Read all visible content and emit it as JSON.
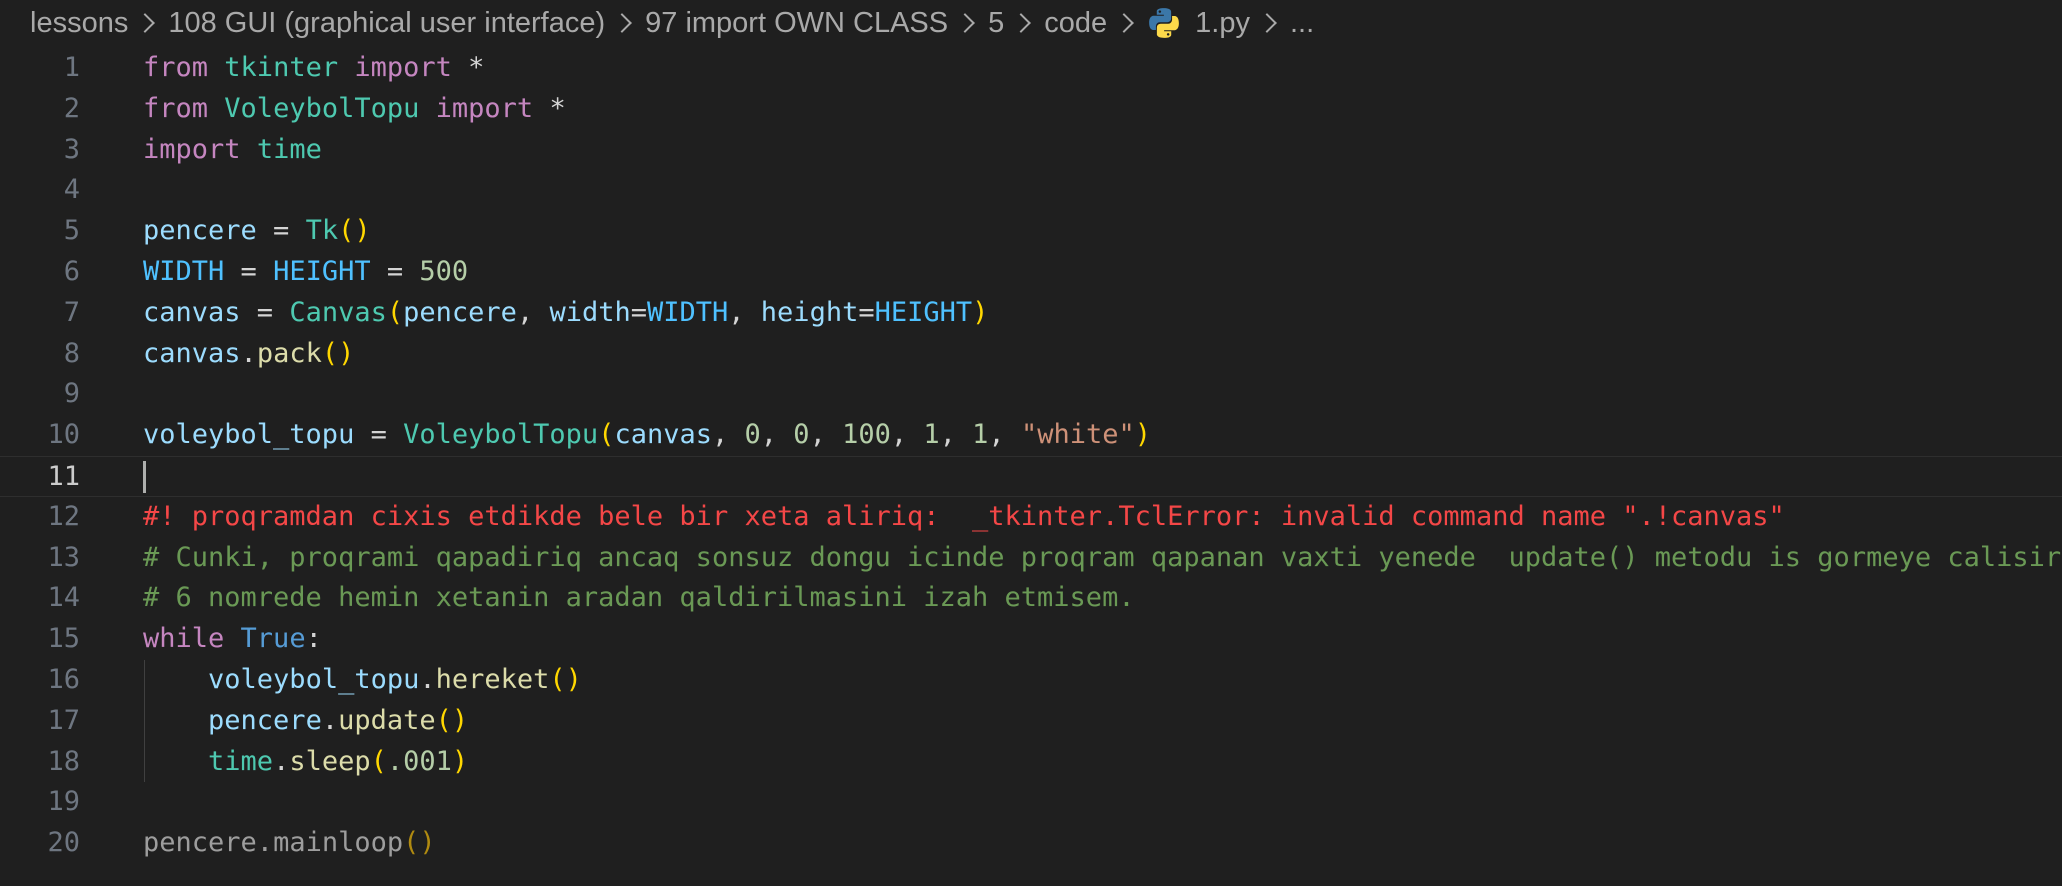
{
  "breadcrumb": {
    "items": [
      {
        "label": "lessons"
      },
      {
        "label": "108 GUI (graphical user interface)"
      },
      {
        "label": "97 import OWN CLASS"
      },
      {
        "label": "5"
      },
      {
        "label": "code"
      },
      {
        "label": "1.py",
        "icon": "python-icon"
      },
      {
        "label": "..."
      }
    ]
  },
  "editor": {
    "language": "python",
    "current_line": 11,
    "colors": {
      "background": "#1f1f1f",
      "keyword": "#c586c0",
      "variable": "#9cdcfe",
      "constant": "#4fc1ff",
      "class": "#4ec9b0",
      "function": "#dcdcaa",
      "number": "#b5cea8",
      "string": "#ce9178",
      "bracket": "#ffd700",
      "comment": "#6a9955",
      "alert_comment": "#f44747"
    },
    "lines": [
      {
        "number": "1",
        "tokens": [
          {
            "t": "keyword",
            "v": "from"
          },
          {
            "t": "plain",
            "v": " "
          },
          {
            "t": "module",
            "v": "tkinter"
          },
          {
            "t": "plain",
            "v": " "
          },
          {
            "t": "keyword",
            "v": "import"
          },
          {
            "t": "plain",
            "v": " *"
          }
        ]
      },
      {
        "number": "2",
        "tokens": [
          {
            "t": "keyword",
            "v": "from"
          },
          {
            "t": "plain",
            "v": " "
          },
          {
            "t": "module",
            "v": "VoleybolTopu"
          },
          {
            "t": "plain",
            "v": " "
          },
          {
            "t": "keyword",
            "v": "import"
          },
          {
            "t": "plain",
            "v": " *"
          }
        ]
      },
      {
        "number": "3",
        "tokens": [
          {
            "t": "keyword",
            "v": "import"
          },
          {
            "t": "plain",
            "v": " "
          },
          {
            "t": "module",
            "v": "time"
          }
        ]
      },
      {
        "number": "4",
        "tokens": []
      },
      {
        "number": "5",
        "tokens": [
          {
            "t": "name",
            "v": "pencere"
          },
          {
            "t": "op",
            "v": " = "
          },
          {
            "t": "class",
            "v": "Tk"
          },
          {
            "t": "paren",
            "v": "()"
          }
        ]
      },
      {
        "number": "6",
        "tokens": [
          {
            "t": "const",
            "v": "WIDTH"
          },
          {
            "t": "op",
            "v": " = "
          },
          {
            "t": "const",
            "v": "HEIGHT"
          },
          {
            "t": "op",
            "v": " = "
          },
          {
            "t": "number",
            "v": "500"
          }
        ]
      },
      {
        "number": "7",
        "tokens": [
          {
            "t": "name",
            "v": "canvas"
          },
          {
            "t": "op",
            "v": " = "
          },
          {
            "t": "class",
            "v": "Canvas"
          },
          {
            "t": "paren",
            "v": "("
          },
          {
            "t": "name",
            "v": "pencere"
          },
          {
            "t": "op",
            "v": ", "
          },
          {
            "t": "name",
            "v": "width"
          },
          {
            "t": "op",
            "v": "="
          },
          {
            "t": "const",
            "v": "WIDTH"
          },
          {
            "t": "op",
            "v": ", "
          },
          {
            "t": "name",
            "v": "height"
          },
          {
            "t": "op",
            "v": "="
          },
          {
            "t": "const",
            "v": "HEIGHT"
          },
          {
            "t": "paren",
            "v": ")"
          }
        ]
      },
      {
        "number": "8",
        "tokens": [
          {
            "t": "name",
            "v": "canvas"
          },
          {
            "t": "op",
            "v": "."
          },
          {
            "t": "func",
            "v": "pack"
          },
          {
            "t": "paren",
            "v": "()"
          }
        ]
      },
      {
        "number": "9",
        "tokens": []
      },
      {
        "number": "10",
        "tokens": [
          {
            "t": "name",
            "v": "voleybol_topu"
          },
          {
            "t": "op",
            "v": " = "
          },
          {
            "t": "class",
            "v": "VoleybolTopu"
          },
          {
            "t": "paren",
            "v": "("
          },
          {
            "t": "name",
            "v": "canvas"
          },
          {
            "t": "op",
            "v": ", "
          },
          {
            "t": "number",
            "v": "0"
          },
          {
            "t": "op",
            "v": ", "
          },
          {
            "t": "number",
            "v": "0"
          },
          {
            "t": "op",
            "v": ", "
          },
          {
            "t": "number",
            "v": "100"
          },
          {
            "t": "op",
            "v": ", "
          },
          {
            "t": "number",
            "v": "1"
          },
          {
            "t": "op",
            "v": ", "
          },
          {
            "t": "number",
            "v": "1"
          },
          {
            "t": "op",
            "v": ", "
          },
          {
            "t": "string",
            "v": "\"white\""
          },
          {
            "t": "paren",
            "v": ")"
          }
        ]
      },
      {
        "number": "11",
        "tokens": [],
        "current": true
      },
      {
        "number": "12",
        "tokens": [
          {
            "t": "alert",
            "v": "#! proqramdan cixis etdikde bele bir xeta aliriq:  _tkinter.TclError: invalid command name \".!canvas\""
          }
        ]
      },
      {
        "number": "13",
        "tokens": [
          {
            "t": "comment",
            "v": "# Cunki, proqrami qapadiriq ancaq sonsuz dongu icinde proqram qapanan vaxti yenede  update() metodu is gormeye calisir."
          }
        ]
      },
      {
        "number": "14",
        "tokens": [
          {
            "t": "comment",
            "v": "# 6 nomrede hemin xetanin aradan qaldirilmasini izah etmisem."
          }
        ]
      },
      {
        "number": "15",
        "tokens": [
          {
            "t": "keyword",
            "v": "while"
          },
          {
            "t": "plain",
            "v": " "
          },
          {
            "t": "bool",
            "v": "True"
          },
          {
            "t": "op",
            "v": ":"
          }
        ]
      },
      {
        "number": "16",
        "indent": true,
        "tokens": [
          {
            "t": "plain",
            "v": "    "
          },
          {
            "t": "name",
            "v": "voleybol_topu"
          },
          {
            "t": "op",
            "v": "."
          },
          {
            "t": "func",
            "v": "hereket"
          },
          {
            "t": "paren",
            "v": "()"
          }
        ]
      },
      {
        "number": "17",
        "indent": true,
        "tokens": [
          {
            "t": "plain",
            "v": "    "
          },
          {
            "t": "name",
            "v": "pencere"
          },
          {
            "t": "op",
            "v": "."
          },
          {
            "t": "func",
            "v": "update"
          },
          {
            "t": "paren",
            "v": "()"
          }
        ]
      },
      {
        "number": "18",
        "indent": true,
        "tokens": [
          {
            "t": "plain",
            "v": "    "
          },
          {
            "t": "module",
            "v": "time"
          },
          {
            "t": "op",
            "v": "."
          },
          {
            "t": "func",
            "v": "sleep"
          },
          {
            "t": "paren",
            "v": "("
          },
          {
            "t": "number",
            "v": ".001"
          },
          {
            "t": "paren",
            "v": ")"
          }
        ]
      },
      {
        "number": "19",
        "tokens": []
      },
      {
        "number": "20",
        "tokens": [
          {
            "t": "dim",
            "v": "pencere"
          },
          {
            "t": "dim",
            "v": "."
          },
          {
            "t": "dim",
            "v": "mainloop"
          },
          {
            "t": "dimparen",
            "v": "()"
          }
        ]
      }
    ]
  }
}
